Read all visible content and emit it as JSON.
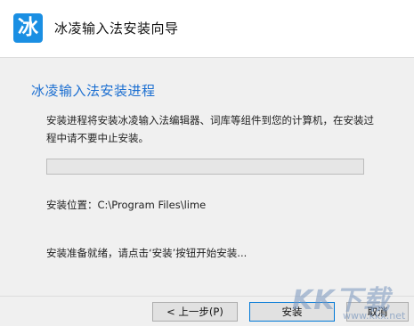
{
  "window": {
    "title": "冰凌输入法安装向导",
    "icon_glyph": "冰",
    "icon_color": "#1a8fe3"
  },
  "main": {
    "heading": "冰凌输入法安装进程",
    "heading_color": "#1c6fd1",
    "description": "安装进程将安装冰凌输入法编辑器、词库等组件到您的计算机，在安装过程中请不要中止安装。",
    "progress": 0,
    "install_location": "安装位置：C:\\Program Files\\lime",
    "ready_text": "安装准备就绪，请点击‘安装’按钮开始安装..."
  },
  "footer": {
    "back_label": "< 上一步(P)",
    "install_label": "安装",
    "cancel_label": "取消"
  },
  "watermark": {
    "brand": "KK下载",
    "url": "www.kkx.net"
  }
}
